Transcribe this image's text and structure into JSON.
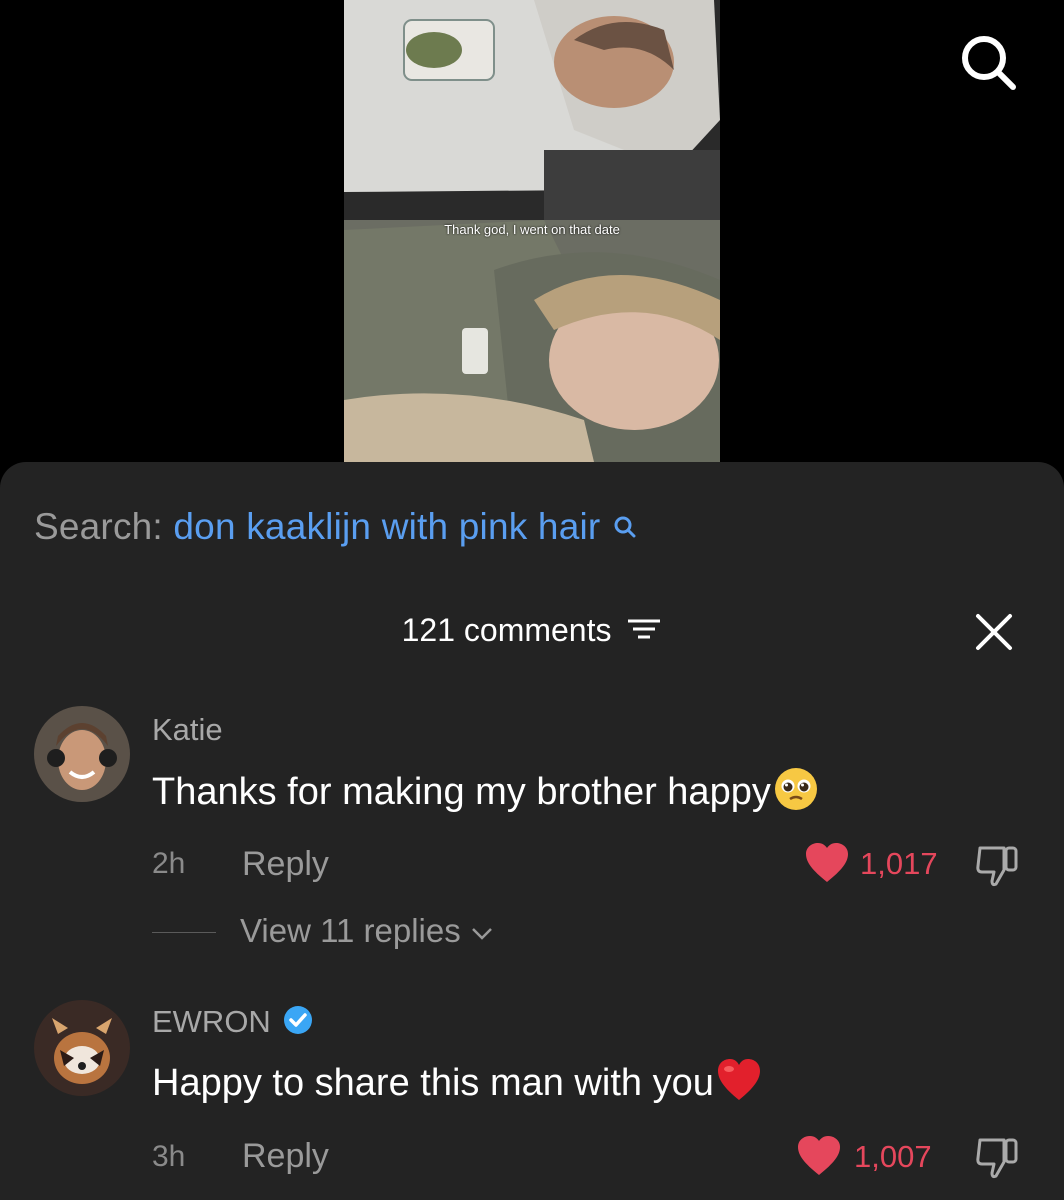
{
  "video": {
    "caption": "Thank god, I went on that date"
  },
  "header": {
    "search_prefix": "Search:",
    "search_query": "don kaaklijn with pink hair",
    "comment_count": "121 comments"
  },
  "comments": [
    {
      "username": "Katie",
      "text": "Thanks for making my brother happy",
      "emoji": "pleading-face",
      "time": "2h",
      "reply_label": "Reply",
      "likes": "1,017",
      "view_replies": "View 11 replies"
    },
    {
      "username": "EWRON",
      "verified": true,
      "text": "Happy to share this man with you",
      "emoji": "red-heart",
      "time": "3h",
      "reply_label": "Reply",
      "likes": "1,007"
    }
  ],
  "colors": {
    "sheet": "#232323",
    "search_link": "#5a9ef0",
    "like": "#e5475c",
    "verified": "#3aa6f5"
  }
}
